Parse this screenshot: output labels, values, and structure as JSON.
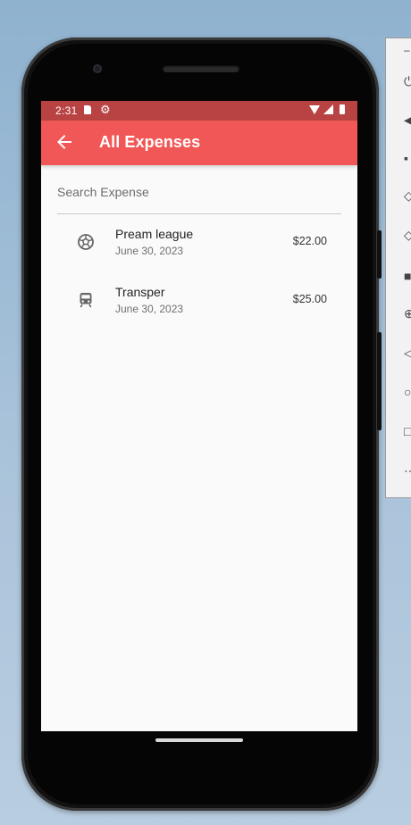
{
  "status_bar": {
    "time": "2:31"
  },
  "app_bar": {
    "title": "All Expenses"
  },
  "search": {
    "placeholder": "Search Expense"
  },
  "expenses": [
    {
      "title": "Pream league",
      "date": "June 30, 2023",
      "amount": "$22.00",
      "icon": "soccer-ball-icon"
    },
    {
      "title": "Transper",
      "date": "June 30, 2023",
      "amount": "$25.00",
      "icon": "train-icon"
    }
  ],
  "colors": {
    "app_bar": "#f15757",
    "status_bar": "#b94343",
    "background": "#fafafa"
  },
  "emulator_toolbar": {
    "tools": [
      "minimize-icon",
      "power-icon",
      "volume-up-icon",
      "volume-down-icon",
      "rotate-left-icon",
      "rotate-right-icon",
      "camera-icon",
      "zoom-icon",
      "back-icon",
      "home-icon",
      "overview-icon",
      "more-icon"
    ]
  }
}
